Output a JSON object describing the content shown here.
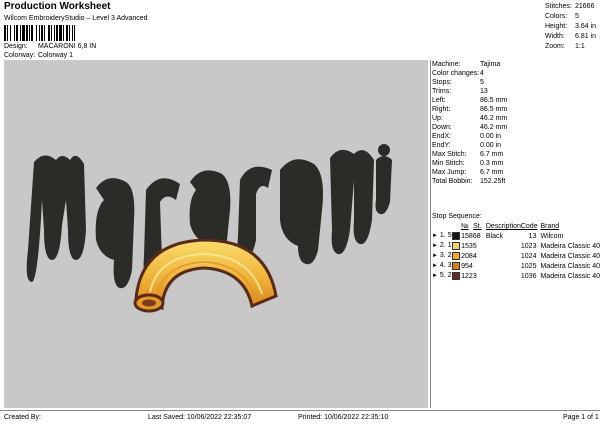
{
  "header": {
    "title": "Production Worksheet",
    "subtitle": "Wilcom EmbroideryStudio – Level 3 Advanced",
    "design_label": "Design:",
    "design_value": "MACARONI 6,8 IN",
    "colorway_label": "Colorway:",
    "colorway_value": "Colorway 1"
  },
  "summary": [
    {
      "k": "Stitches:",
      "v": "21666"
    },
    {
      "k": "Colors:",
      "v": "5"
    },
    {
      "k": "Height:",
      "v": "3.64 in"
    },
    {
      "k": "Width:",
      "v": "6.81 in"
    },
    {
      "k": "Zoom:",
      "v": "1:1"
    }
  ],
  "design_preview": {
    "word": "Macaroni",
    "text_color": "#2b2b27"
  },
  "info": [
    {
      "k": "Machine:",
      "v": "Tajima"
    },
    {
      "k": "Color changes:",
      "v": "4"
    },
    {
      "k": "Stops:",
      "v": "5"
    },
    {
      "k": "Trims:",
      "v": "13"
    },
    {
      "k": "Left:",
      "v": "86.5 mm"
    },
    {
      "k": "Right:",
      "v": "86.5 mm"
    },
    {
      "k": "Up:",
      "v": "46.2 mm"
    },
    {
      "k": "Down:",
      "v": "46.2 mm"
    },
    {
      "k": "EndX:",
      "v": "0.00 in"
    },
    {
      "k": "EndY:",
      "v": "0.00 in"
    },
    {
      "k": "Max Stitch:",
      "v": "6.7 mm"
    },
    {
      "k": "Min Stitch:",
      "v": "0.3 mm"
    },
    {
      "k": "Max Jump:",
      "v": "6.7 mm"
    },
    {
      "k": "Total Bobbin:",
      "v": "152.25ft"
    }
  ],
  "stop_sequence": {
    "heading": "Stop Sequence:",
    "columns": [
      "№",
      "St.",
      "Description",
      "Code",
      "Brand"
    ],
    "rows": [
      {
        "idx": "1.",
        "n": "5",
        "color": "#111111",
        "st": "15868",
        "desc": "Black",
        "code": "13",
        "brand": "Wilcom"
      },
      {
        "idx": "2.",
        "n": "1",
        "color": "#f5d36b",
        "st": "1535",
        "desc": "",
        "code": "1023",
        "brand": "Madeira Classic 40"
      },
      {
        "idx": "3.",
        "n": "2",
        "color": "#f0a92a",
        "st": "2084",
        "desc": "",
        "code": "1024",
        "brand": "Madeira Classic 40"
      },
      {
        "idx": "4.",
        "n": "3",
        "color": "#d9821c",
        "st": "954",
        "desc": "",
        "code": "1025",
        "brand": "Madeira Classic 40"
      },
      {
        "idx": "5.",
        "n": "2",
        "color": "#6b2a1f",
        "st": "1223",
        "desc": "",
        "code": "1036",
        "brand": "Madeira Classic 40"
      }
    ]
  },
  "footer": {
    "created": "Created By:",
    "saved": "Last Saved: 10/06/2022 22:35:07",
    "printed": "Printed: 10/06/2022 22:35:10",
    "page": "Page 1 of 1"
  }
}
